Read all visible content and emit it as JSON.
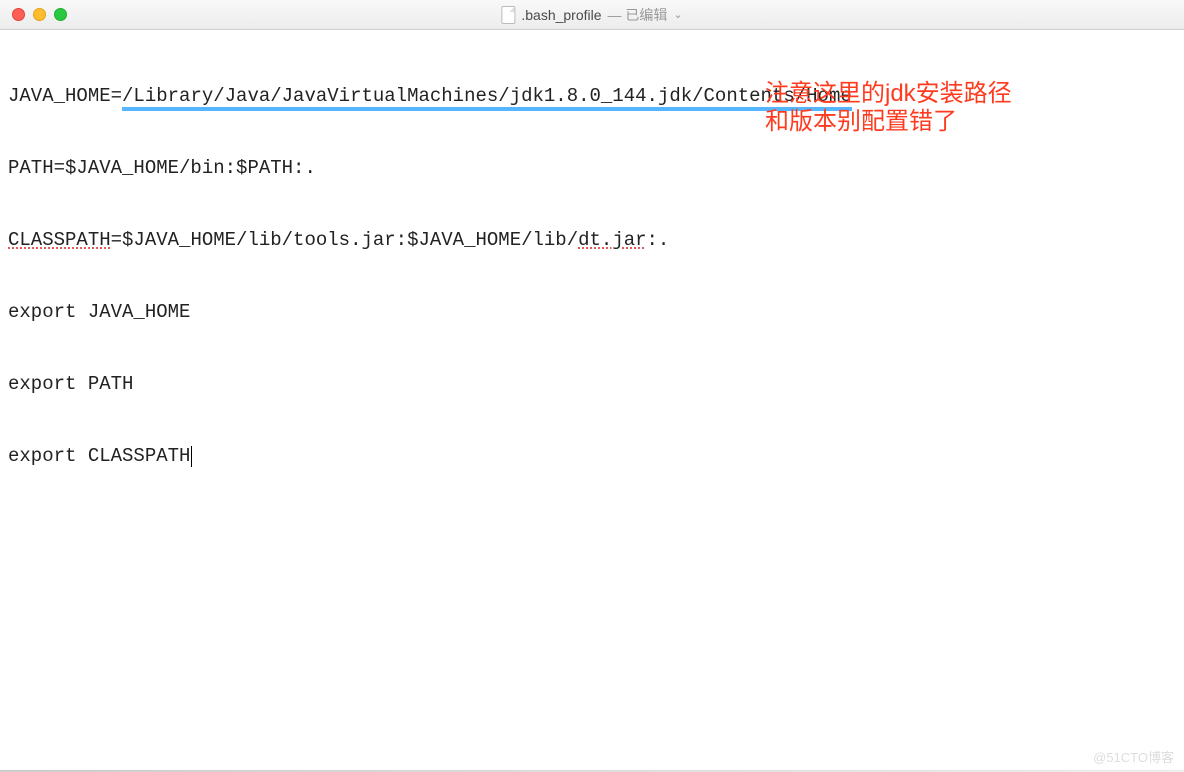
{
  "titlebar": {
    "filename": ".bash_profile",
    "separator": " — ",
    "status": "已编辑"
  },
  "editor": {
    "lines": [
      {
        "prefix": "JAVA_HOME=",
        "highlighted": "/Library/Java/JavaVirtualMachines/jdk1.8.0_144.jdk/Contents/Home",
        "suffix": ""
      },
      {
        "text": "PATH=$JAVA_HOME/bin:$PATH:."
      },
      {
        "prefix": "CLASSPATH",
        "rest": "=$JAVA_HOME/lib/tools.jar:$JAVA_HOME/lib/",
        "spell": "dt.jar",
        "tail": ":."
      },
      {
        "text": "export JAVA_HOME"
      },
      {
        "text": "export PATH"
      },
      {
        "text": "export CLASSPATH"
      }
    ]
  },
  "annotations": {
    "line1": "注意这里的jdk安装路径",
    "line2": "和版本别配置错了"
  },
  "watermark": "@51CTO博客"
}
